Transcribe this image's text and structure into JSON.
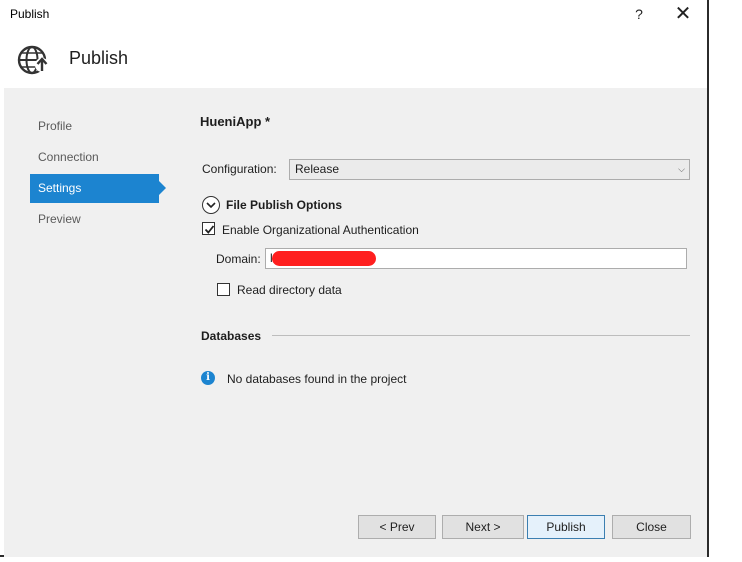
{
  "window": {
    "title": "Publish",
    "help_label": "?",
    "close_label": "✕"
  },
  "header": {
    "title": "Publish",
    "icon": "globe-publish-icon"
  },
  "nav": {
    "items": [
      {
        "label": "Profile",
        "active": false
      },
      {
        "label": "Connection",
        "active": false
      },
      {
        "label": "Settings",
        "active": true
      },
      {
        "label": "Preview",
        "active": false
      }
    ]
  },
  "settings": {
    "app_title": "HueniApp *",
    "configuration_label": "Configuration:",
    "configuration_value": "Release",
    "file_publish_options_label": "File Publish Options",
    "enable_org_auth_label": "Enable Organizational Authentication",
    "enable_org_auth_checked": true,
    "domain_label": "Domain:",
    "domain_value": "l",
    "read_directory_label": "Read directory data",
    "read_directory_checked": false
  },
  "databases": {
    "heading": "Databases",
    "info_glyph": "i",
    "message": "No databases found in the project"
  },
  "buttons": {
    "prev": "< Prev",
    "next": "Next >",
    "publish": "Publish",
    "close": "Close"
  },
  "colors": {
    "accent": "#1c84d0",
    "panel_bg": "#f0f0f0",
    "redaction": "#ff1f1f"
  }
}
